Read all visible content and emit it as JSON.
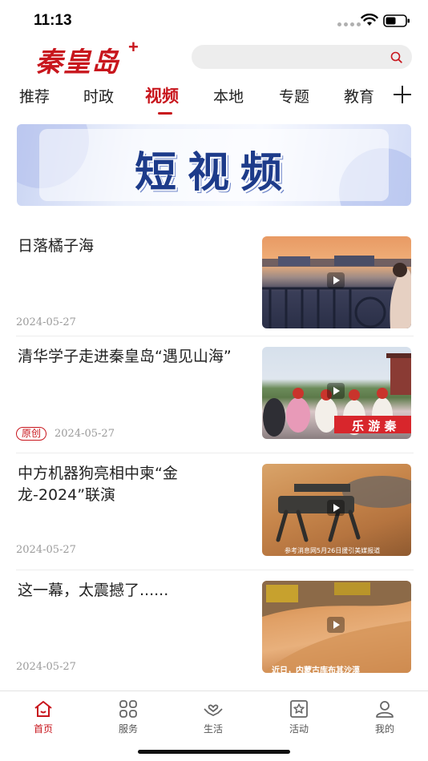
{
  "status_bar": {
    "time": "11:13"
  },
  "header": {
    "logo_text": "秦皇岛",
    "logo_plus": "+",
    "search_placeholder": ""
  },
  "tabs": [
    {
      "label": "推荐"
    },
    {
      "label": "时政"
    },
    {
      "label": "视频",
      "active": true
    },
    {
      "label": "本地"
    },
    {
      "label": "专题"
    },
    {
      "label": "教育"
    }
  ],
  "banner": {
    "title": "短视频"
  },
  "news": [
    {
      "title": "日落橘子海",
      "date": "2024-05-27",
      "badge": ""
    },
    {
      "title": "清华学子走进秦皇岛“遇见山海”",
      "date": "2024-05-27",
      "badge": "原创"
    },
    {
      "title": "中方机器狗亮相中柬“金龙-2024”联演",
      "date": "2024-05-27",
      "badge": ""
    },
    {
      "title": "这一幕，太震撼了......",
      "date": "2024-05-27",
      "badge": ""
    }
  ],
  "thumb_captions": {
    "t2_banner": "乐 游 秦",
    "t3_caption": "参考消息网5月26日援引美媒报道",
    "t4_caption": "近日，内蒙古库布其沙漠"
  },
  "tabbar": [
    {
      "label": "首页",
      "icon": "home-icon",
      "active": true
    },
    {
      "label": "服务",
      "icon": "service-grid-icon"
    },
    {
      "label": "生活",
      "icon": "life-hands-icon"
    },
    {
      "label": "活动",
      "icon": "activity-star-icon"
    },
    {
      "label": "我的",
      "icon": "profile-icon"
    }
  ],
  "colors": {
    "accent": "#c8161d",
    "banner_text": "#1d3b8a"
  }
}
